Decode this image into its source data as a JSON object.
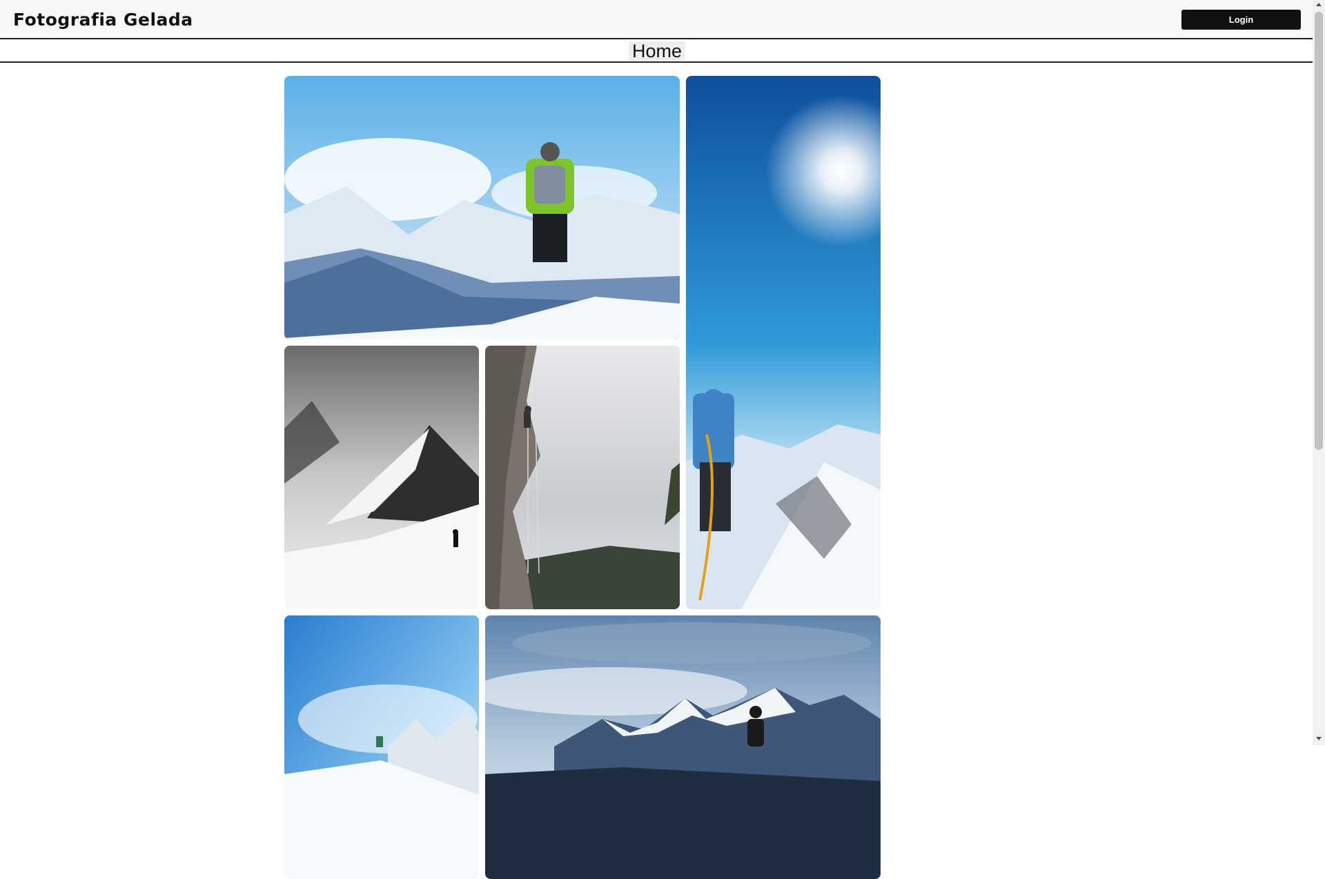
{
  "header": {
    "brand": "Fotografia Gelada",
    "login_label": "Login"
  },
  "nav": {
    "home_label": "Home"
  },
  "gallery": {
    "photos": [
      {
        "name": "hiker-green-jacket-photo"
      },
      {
        "name": "sun-climber-rope-photo"
      },
      {
        "name": "bw-snow-peak-hiker-photo"
      },
      {
        "name": "rock-face-climber-photo"
      },
      {
        "name": "skier-blue-sky-photo"
      },
      {
        "name": "mountain-range-person-photo"
      }
    ]
  }
}
